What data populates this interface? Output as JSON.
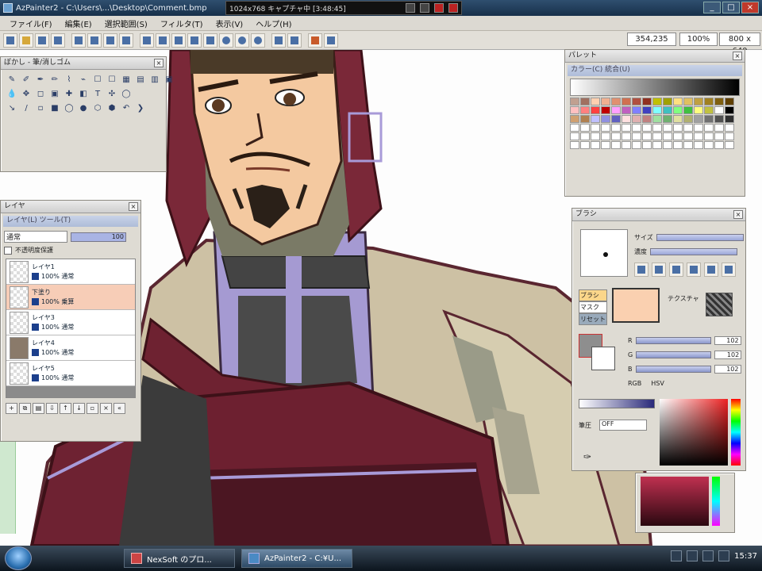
{
  "window": {
    "title": "AzPainter2 - C:\\Users\\...\\Desktop\\Comment.bmp"
  },
  "overlay": {
    "text": "1024x768  キャプチャ中  [3:48:45]"
  },
  "menu": [
    "ファイル(F)",
    "編集(E)",
    "選択範囲(S)",
    "フィルタ(T)",
    "表示(V)",
    "ヘルプ(H)"
  ],
  "status": {
    "coords": "354,235",
    "zoom": "100%",
    "size": "800 x 640"
  },
  "tool_panel": {
    "title": "ぼかし - 筆/消しゴム",
    "tools_row1": [
      "✎",
      "✐",
      "✒",
      "✏",
      "⌇",
      "⌁",
      "☐",
      "☐",
      "▦",
      "▤",
      "▥",
      "▣"
    ],
    "tools_row2": [
      "💧",
      "✥",
      "◻",
      "▣",
      "✚",
      "◧",
      "T",
      "✣",
      "◯",
      "",
      "",
      ""
    ],
    "tools_row3": [
      "↘",
      "/",
      "▫",
      "■",
      "◯",
      "●",
      "⬡",
      "⬢",
      "↶",
      "❯",
      "",
      ""
    ]
  },
  "layer_panel": {
    "title": "レイヤ",
    "tab": "レイヤ(L)  ツール(T)",
    "blend_mode": "通常",
    "opacity": "100",
    "lock_label": "不透明度保護",
    "layers": [
      {
        "name": "レイヤ1",
        "info": "100% 通常"
      },
      {
        "name": "下塗り",
        "info": "100% 乗算"
      },
      {
        "name": "レイヤ3",
        "info": "100% 通常"
      },
      {
        "name": "レイヤ4",
        "info": "100% 通常"
      },
      {
        "name": "レイヤ5",
        "info": "100% 通常"
      }
    ]
  },
  "color_panel": {
    "title": "パレット",
    "tab": "カラー(C)  統合(U)"
  },
  "brush_panel": {
    "title": "ブラシ",
    "size_label": "サイズ",
    "density_label": "濃度",
    "mode_items": [
      "ブラシ",
      "マスク",
      "リセット"
    ],
    "texture_label": "テクスチャ",
    "r_label": "R",
    "g_label": "G",
    "b_label": "B",
    "r_val": "102",
    "g_val": "102",
    "b_val": "102",
    "rgb_label": "RGB",
    "hsv_label": "HSV",
    "pressure_label": "筆圧",
    "pressure_value": "OFF"
  },
  "taskbar": {
    "tasks": [
      {
        "label": "NexSoft のプロ..."
      },
      {
        "label": "AzPainter2 - C:¥U..."
      }
    ],
    "clock": "15:37"
  }
}
